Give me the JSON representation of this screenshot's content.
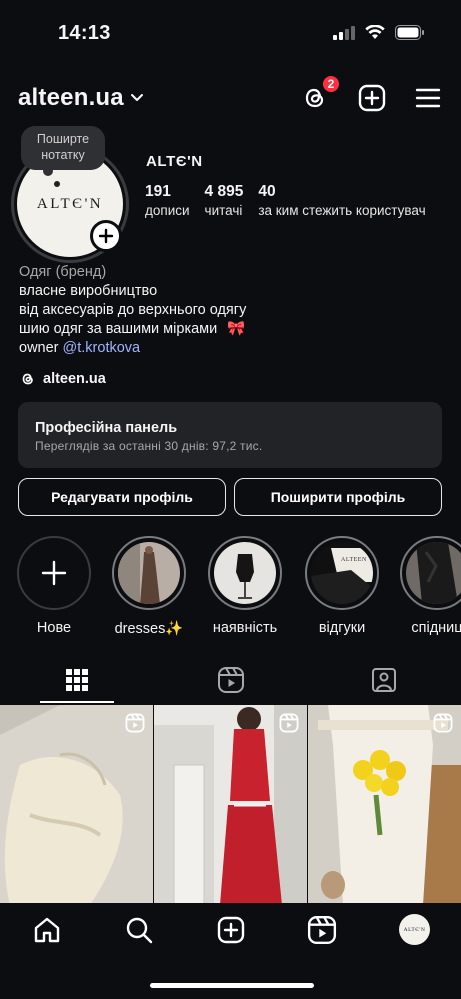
{
  "status": {
    "time": "14:13"
  },
  "header": {
    "username": "alteen.ua",
    "threads_badge": "2"
  },
  "profile": {
    "note_prompt": "Поширте нотатку",
    "avatar_text": "ALTЄ'N",
    "name": "ALTЄ'N",
    "stats": [
      {
        "value": "191",
        "label": "дописи"
      },
      {
        "value": "4 895",
        "label": "читачі"
      },
      {
        "value": "40",
        "label": "за ким стежить користувач"
      }
    ],
    "bio": {
      "category": "Одяг (бренд)",
      "line1": "власне виробництво",
      "line2": "від аксесуарів до верхнього одягу",
      "line3": "шию одяг за вашими мірками",
      "line3_emoji": "🎀",
      "owner_prefix": "owner",
      "owner_mention": "@t.krotkova"
    },
    "threads_handle": "alteen.ua"
  },
  "pro_panel": {
    "title": "Професійна панель",
    "subtitle": "Переглядів за останні 30 днів: 97,2 тис."
  },
  "buttons": {
    "edit": "Редагувати профіль",
    "share": "Поширити профіль"
  },
  "highlights": [
    {
      "label": "Нове"
    },
    {
      "label": "dresses✨"
    },
    {
      "label": "наявність"
    },
    {
      "label": "відгуки"
    },
    {
      "label": "спідниц"
    }
  ],
  "highlight_thumb_text": "ALTEEN",
  "nav_avatar_text": "ALTЄ'N",
  "colors": {
    "accent_link": "#9fb5ff",
    "badge": "#ff2f40",
    "background": "#0c0d10"
  }
}
